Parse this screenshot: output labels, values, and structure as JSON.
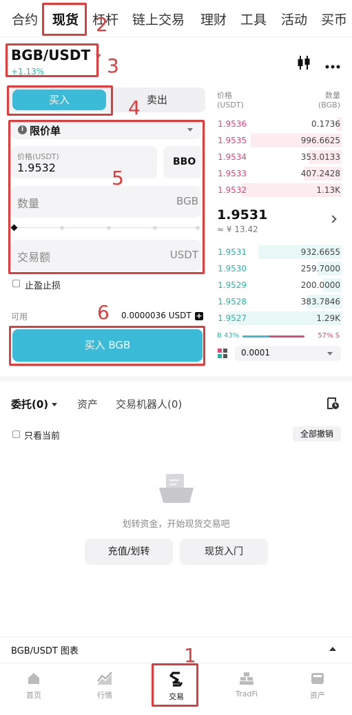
{
  "top_tabs": [
    "合约",
    "现货",
    "杠杆",
    "链上交易",
    "理财",
    "工具",
    "活动",
    "买币"
  ],
  "pair": {
    "symbol": "BGB/USDT",
    "change": "+1.13%"
  },
  "trade": {
    "buy_label": "买入",
    "sell_label": "卖出",
    "order_type": "限价单",
    "price_label": "价格(USDT)",
    "price_value": "1.9532",
    "bbo_label": "BBO",
    "qty_label": "数量",
    "qty_unit": "BGB",
    "amount_label": "交易额",
    "amount_unit": "USDT",
    "tpsl_label": "止盈止损",
    "available_label": "可用",
    "available_value": "0.0000036 USDT",
    "submit_label": "买入 BGB"
  },
  "orderbook": {
    "price_header": "价格\n(USDT)",
    "qty_header": "数量\n(BGB)",
    "asks": [
      {
        "price": "1.9536",
        "qty": "0.1736"
      },
      {
        "price": "1.9535",
        "qty": "996.6625"
      },
      {
        "price": "1.9534",
        "qty": "353.0133"
      },
      {
        "price": "1.9533",
        "qty": "407.2428"
      },
      {
        "price": "1.9532",
        "qty": "1.13K"
      }
    ],
    "last_price": "1.9531",
    "last_fiat": "≈ ¥ 13.42",
    "bids": [
      {
        "price": "1.9531",
        "qty": "932.6655"
      },
      {
        "price": "1.9530",
        "qty": "259.7000"
      },
      {
        "price": "1.9529",
        "qty": "200.0000"
      },
      {
        "price": "1.9528",
        "qty": "383.7846"
      },
      {
        "price": "1.9527",
        "qty": "1.29K"
      }
    ],
    "buy_ratio": "B 43%",
    "sell_ratio": "57% S",
    "buy_fraction": 0.43,
    "precision": "0.0001"
  },
  "orders": {
    "tabs": [
      "委托(0)",
      "资产",
      "交易机器人(0)"
    ],
    "only_current": "只看当前",
    "cancel_all": "全部撤销",
    "empty_text": "划转资金，开始现货交易吧",
    "deposit_btn": "充值/划转",
    "intro_btn": "现货入门"
  },
  "chart_bar_label": "BGB/USDT 图表",
  "bottom_nav": [
    "首页",
    "行情",
    "交易",
    "TradFi",
    "资产"
  ],
  "annotations": [
    "1",
    "2",
    "3",
    "4",
    "5",
    "6"
  ],
  "colors": {
    "accent": "#3bbbd8",
    "ask": "#e0467a",
    "bid": "#2ab5a5",
    "annotation": "#e23b3b"
  }
}
